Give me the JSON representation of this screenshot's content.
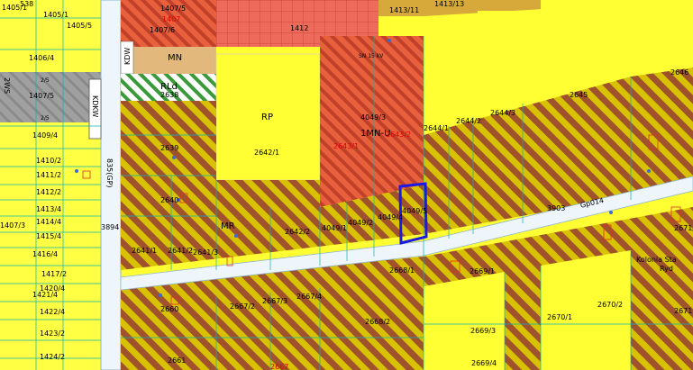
{
  "colors": {
    "yellow": "#ffff33",
    "hatch_brown": "#a0522d",
    "hatch_olive": "#bfb100",
    "red_zone": "#e85a4f",
    "gray": "#9a9a9a",
    "road": "#eef6fb",
    "selection": "#1a1ae6",
    "boundary": "#0fb0b0",
    "green": "#3a9a3a",
    "pink": "#f08070"
  },
  "labels": {
    "p538": "538",
    "p1405_1": "1405/1",
    "p1405_5": "1405/5",
    "p1406_4": "1406/4",
    "zone_2ws": "2WS",
    "p1407_5_left": "1407/5",
    "p1409_4": "1409/4",
    "p1410_2": "1410/2",
    "p1411_2": "1411/2",
    "p1412_2": "1412/2",
    "p1413_4": "1413/4",
    "p1414_4": "1414/4",
    "p1415_4": "1415/4",
    "p1416_4": "1416/4",
    "p1417_2": "1417/2",
    "p1420_4": "1420/4",
    "p1421_4": "1421/4",
    "p1422_4": "1422/4",
    "p1423_2": "1423/2",
    "p1424_2": "1424/2",
    "p1407_3": "1407/3",
    "kdkw_v": "KDKW",
    "road_835": "835(GP)",
    "p3894": "3894",
    "p1407_5_top": "1407/5",
    "p1407_red": "1407",
    "p1407_6": "1407/6",
    "p1412": "1412",
    "kdw": "KDW",
    "zone_mn": "MN",
    "zone_rld": "RLd",
    "p2638": "2638",
    "zone_rp": "RP",
    "p2642_1": "2642/1",
    "p2639": "2639",
    "p2640": "2640",
    "zone_mr": "MR",
    "p2641_1": "2641/1",
    "p2641_2": "2641/2",
    "p2641_3": "2641/3",
    "p2642_2": "2642/2",
    "p4049_1": "4049/1",
    "p4049_2": "4049/2",
    "p4049_4": "4049/4",
    "p4049_5": "4049/5",
    "p4049_3": "4049/3",
    "zone_1mnu": "1MN-U",
    "p2643_2": "2643/2",
    "p2643_1": "2643/1",
    "sn_kv": "SN 15 kV",
    "p1413_11": "1413/11",
    "p1413_13": "1413/13",
    "p2644_1": "2644/1",
    "p2644_2": "2644/2",
    "p2644_3": "2644/3",
    "p2645": "2645",
    "p2646": "2646",
    "p3903": "3903",
    "road_gp014": "Gp014",
    "p2668_1": "2668/1",
    "p2669_1": "2669/1",
    "p2671_1": "2671/1",
    "kolonia_a": "Kolonia Sta",
    "kolonia_b": "Ryd",
    "p2660": "2660",
    "p2667_2": "2667/2",
    "p2667_3": "2667/3",
    "p2667_4": "2667/4",
    "p2668_2": "2668/2",
    "p2669_3": "2669/3",
    "p2670_1": "2670/1",
    "p2670_2": "2670/2",
    "p2671": "2671",
    "p2661": "2661",
    "p2667": "2667",
    "p2669_4": "2669/4",
    "tiny_a": "2/5",
    "tiny_b": "2/5"
  }
}
